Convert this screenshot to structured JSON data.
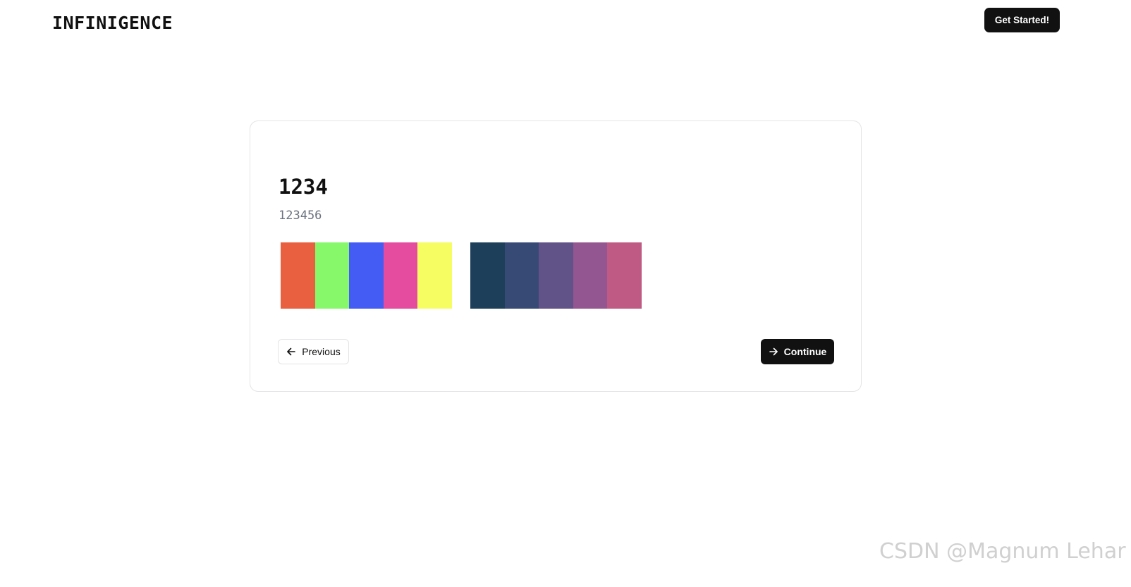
{
  "header": {
    "logo_text": "INFINIGENCE",
    "cta_label": "Get Started!"
  },
  "card": {
    "title": "1234",
    "subtitle": "123456",
    "palettes": [
      {
        "colors": [
          "#E8603F",
          "#86F86A",
          "#445CF4",
          "#E54B9E",
          "#F5FD62"
        ]
      },
      {
        "colors": [
          "#1D3F5A",
          "#374A76",
          "#615287",
          "#945690",
          "#BE5A83"
        ]
      }
    ],
    "previous_label": "Previous",
    "continue_label": "Continue"
  },
  "watermark": {
    "text": "CSDN @Magnum Lehar"
  },
  "colors": {
    "primary": "#111111",
    "border": "#e4e4e7",
    "muted_text": "#6b7280"
  },
  "icons": {
    "previous": "arrow-left-icon",
    "continue": "arrow-right-icon"
  }
}
